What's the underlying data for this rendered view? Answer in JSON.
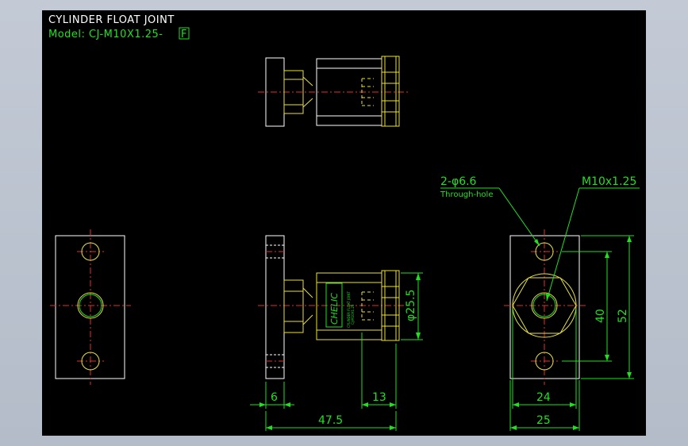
{
  "title": "CYLINDER FLOAT JOINT",
  "model": {
    "prefix": "Model: CJ-M10X1.25-",
    "suffix_boxed": "F"
  },
  "annotations": {
    "holes": "2-φ6.6",
    "holes_note": "Through-hole",
    "thread": "M10x1.25"
  },
  "dimensions": {
    "flange_thickness": "6",
    "nut_width": "13",
    "overall_length": "47.5",
    "body_diameter": "φ25.5",
    "hole_pitch": "40",
    "flange_height": "52",
    "hex_across": "24",
    "flange_width": "25"
  },
  "brand_mark": {
    "logo": "CHELIC",
    "line1": "CYLINDER FLOAT JOINT",
    "line2": "CJ-M10X1.25"
  },
  "colors": {
    "background": "#000000",
    "outline": "#ffffff",
    "part": "#e8e040",
    "dimension": "#20e020",
    "centerline": "#e03030",
    "frame": "#b4bcc9"
  }
}
